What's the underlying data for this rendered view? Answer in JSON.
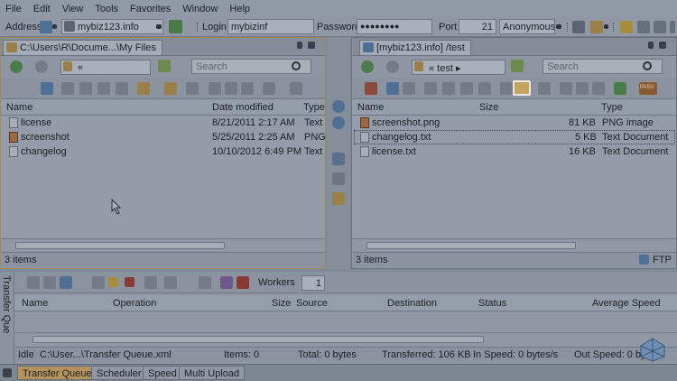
{
  "menu": [
    "File",
    "Edit",
    "View",
    "Tools",
    "Favorites",
    "Window",
    "Help"
  ],
  "address": {
    "label": "Address",
    "host": "mybiz123.info",
    "login_label": "Login",
    "login": "mybizinf",
    "password_label": "Password",
    "password": "●●●●●●●●",
    "port_label": "Port",
    "port": "21",
    "mode": "Anonymous"
  },
  "left_pane": {
    "tab_title": "C:\\Users\\R\\Docume...\\My Files",
    "path": "«",
    "search_placeholder": "Search",
    "columns": [
      "Name",
      "Date modified",
      "Type"
    ],
    "files": [
      {
        "name": "license",
        "date": "8/21/2011 2:17 AM",
        "type": "Text",
        "icon": "text-file-icon"
      },
      {
        "name": "screenshot",
        "date": "5/25/2011 2:25 AM",
        "type": "PNG",
        "icon": "png-file-icon"
      },
      {
        "name": "changelog",
        "date": "10/10/2012 6:49 PM",
        "type": "Text",
        "icon": "text-file-icon"
      }
    ],
    "status": "3 items"
  },
  "right_pane": {
    "tab_title": "[mybiz123.info] /test",
    "path": "« test ▸",
    "search_placeholder": "Search",
    "pasv_label": "PASV",
    "columns": [
      "Name",
      "Size",
      "Type"
    ],
    "files": [
      {
        "name": "screenshot.png",
        "size": "81 KB",
        "type": "PNG image",
        "icon": "png-file-icon"
      },
      {
        "name": "changelog.txt",
        "size": "5 KB",
        "type": "Text Document",
        "icon": "text-file-icon"
      },
      {
        "name": "license.txt",
        "size": "16 KB",
        "type": "Text Document",
        "icon": "text-file-icon"
      }
    ],
    "status": "3 items",
    "protocol": "FTP"
  },
  "queue": {
    "side_label": "Transfer Que",
    "workers_label": "Workers",
    "workers": "1",
    "columns": [
      "Name",
      "Operation",
      "Size",
      "Source",
      "Destination",
      "Status",
      "Average Speed"
    ],
    "status": {
      "state": "Idle",
      "file": "C:\\User...\\Transfer Queue.xml",
      "items": "Items: 0",
      "total": "Total: 0 bytes",
      "transferred": "Transferred: 106 KB",
      "in_speed": "In Speed: 0 bytes/s",
      "out_speed": "Out Speed: 0 bytes/"
    }
  },
  "bottom_tabs": [
    "Transfer Queue",
    "Scheduler",
    "Speed",
    "Multi Upload"
  ],
  "colors": {
    "accent": "#b4935c",
    "overlay": "#7f8997"
  }
}
